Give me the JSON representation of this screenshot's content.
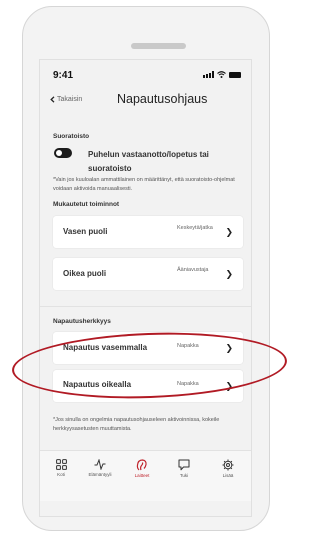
{
  "status_bar": {
    "time": "9:41"
  },
  "header": {
    "back_label": "Takaisin",
    "title": "Napautusohjaus"
  },
  "start_stop": {
    "section_label": "Suoratoisto",
    "toggle_label": "Puhelun vastaanotto/lopetus tai suoratoisto",
    "toggle_state": "off",
    "note": "*Vain jos kuuloalan ammattilainen on määrittänyt, että suoratoisto-ohjelmat voidaan aktivoida manuaalisesti."
  },
  "custom_actions": {
    "section_label": "Mukautetut toiminnot",
    "items": [
      {
        "label": "Vasen puoli",
        "value": "Keskeytä/jatka"
      },
      {
        "label": "Oikea puoli",
        "value": "Ääniavustaja"
      }
    ]
  },
  "sensitivity": {
    "section_label": "Napautusherkkyys",
    "items": [
      {
        "label": "Napautus vasemmalla",
        "value": "Napakka"
      },
      {
        "label": "Napautus oikealla",
        "value": "Napakka"
      }
    ],
    "note": "*Jos sinulla on ongelmia napautusohjauseleen aktivoinnissa, kokeile herkkyysasetusten muuttamista."
  },
  "tabs": [
    {
      "label": "Koti",
      "icon": "home-grid-icon",
      "active": false
    },
    {
      "label": "Elämäntyyli",
      "icon": "activity-icon",
      "active": false
    },
    {
      "label": "Laitteet",
      "icon": "hearing-aid-icon",
      "active": true
    },
    {
      "label": "Tuki",
      "icon": "chat-bubble-icon",
      "active": false
    },
    {
      "label": "Lisää",
      "icon": "gear-icon",
      "active": false
    }
  ],
  "colors": {
    "accent": "#c0262e",
    "highlight_oval": "#b11a24",
    "background": "#f2f2f2"
  }
}
